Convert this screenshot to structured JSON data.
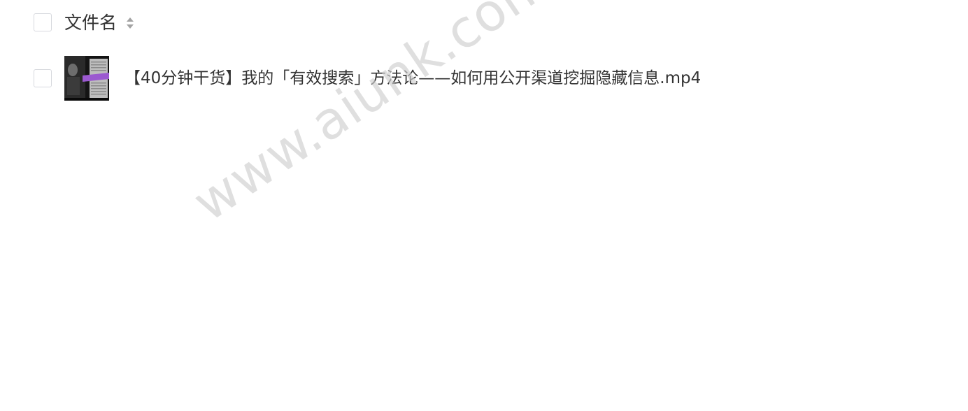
{
  "header": {
    "column_label": "文件名",
    "sort_icon": "sort-caret-icon"
  },
  "files": [
    {
      "name": "【40分钟干货】我的「有效搜索」方法论——如何用公开渠道挖掘隐藏信息.mp4",
      "thumbnail_icon": "video-thumbnail"
    }
  ],
  "watermark": "www.aiunk.com",
  "colors": {
    "text": "#333333",
    "checkbox_border": "#d7d9de",
    "sort_icon": "#a3a3a3",
    "thumbnail_accent": "#9b59d0"
  }
}
